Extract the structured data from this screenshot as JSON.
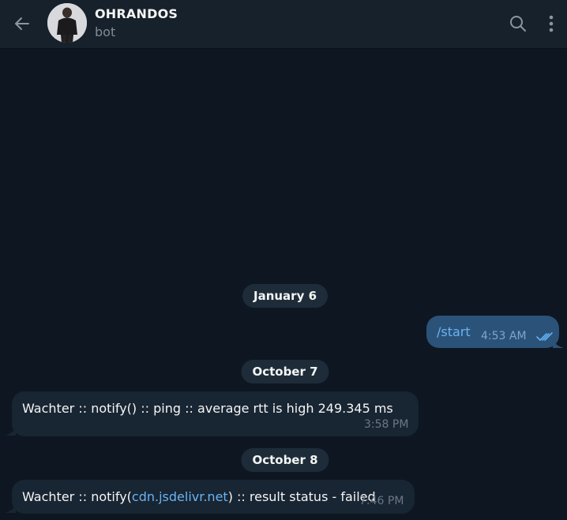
{
  "header": {
    "title": "OHRANDOS",
    "subtitle": "bot",
    "back_icon": "arrow-left-icon",
    "search_icon": "search-icon",
    "more_icon": "more-vertical-icon"
  },
  "colors": {
    "background": "#0e1621",
    "header": "#17212b",
    "incoming_bubble": "#182533",
    "outgoing_bubble": "#2b5278",
    "link": "#6ab3f3",
    "read_check": "#5fb0f0"
  },
  "messages": {
    "date1": "January 6",
    "msg1": {
      "text": "/start",
      "time": "4:53 AM",
      "status": "read"
    },
    "date2": "October 7",
    "msg2": {
      "text": "Wachter :: notify() :: ping :: average rtt is high 249.345 ms",
      "time": "3:58 PM"
    },
    "date3": "October 8",
    "msg3": {
      "text_before": "Wachter :: notify(",
      "link": "cdn.jsdelivr.net",
      "text_after": ") :: result status - failed",
      "time": "7:46 PM"
    }
  }
}
